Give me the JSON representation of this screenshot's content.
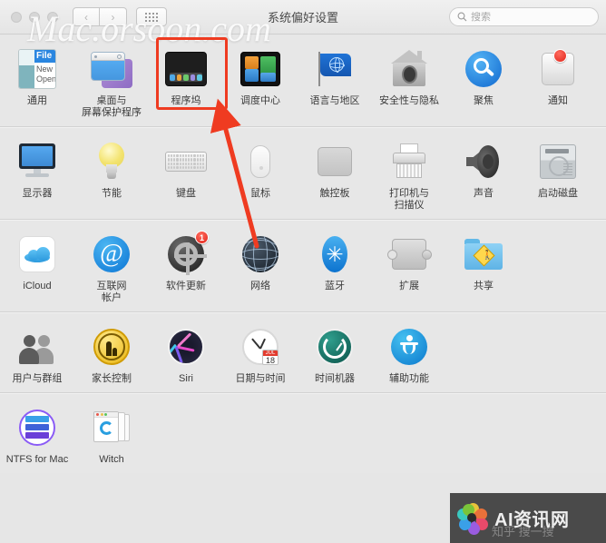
{
  "window": {
    "title": "系统偏好设置",
    "nav": {
      "back": "‹",
      "forward": "›",
      "grid_label": "show-all"
    },
    "search": {
      "placeholder": "搜索",
      "value": "",
      "icon": "search-icon"
    }
  },
  "watermarks": {
    "top": "Mac.orsoon.com",
    "bottom_text": "AI资讯网",
    "bottom_sub": "知乎 搜一搜"
  },
  "annotation": {
    "highlighted_item": "程序坞",
    "highlight_color": "#ef3b21",
    "arrow_color": "#ef3b21"
  },
  "rows": [
    {
      "items": [
        {
          "label": "通用",
          "icon": "general-icon",
          "badge": null
        },
        {
          "label": "桌面与\n屏幕保护程序",
          "icon": "desktop-screensaver-icon",
          "badge": null
        },
        {
          "label": "程序坞",
          "icon": "dock-icon",
          "badge": null
        },
        {
          "label": "调度中心",
          "icon": "mission-control-icon",
          "badge": null
        },
        {
          "label": "语言与地区",
          "icon": "language-region-icon",
          "badge": null
        },
        {
          "label": "安全性与隐私",
          "icon": "security-privacy-icon",
          "badge": null
        },
        {
          "label": "聚焦",
          "icon": "spotlight-icon",
          "badge": null
        },
        {
          "label": "通知",
          "icon": "notifications-icon",
          "badge": " "
        }
      ]
    },
    {
      "items": [
        {
          "label": "显示器",
          "icon": "displays-icon",
          "badge": null
        },
        {
          "label": "节能",
          "icon": "energy-saver-icon",
          "badge": null
        },
        {
          "label": "键盘",
          "icon": "keyboard-icon",
          "badge": null
        },
        {
          "label": "鼠标",
          "icon": "mouse-icon",
          "badge": null
        },
        {
          "label": "触控板",
          "icon": "trackpad-icon",
          "badge": null
        },
        {
          "label": "打印机与\n扫描仪",
          "icon": "printers-scanners-icon",
          "badge": null
        },
        {
          "label": "声音",
          "icon": "sound-icon",
          "badge": null
        },
        {
          "label": "启动磁盘",
          "icon": "startup-disk-icon",
          "badge": null
        }
      ]
    },
    {
      "items": [
        {
          "label": "iCloud",
          "icon": "icloud-icon",
          "badge": null
        },
        {
          "label": "互联网\n帐户",
          "icon": "internet-accounts-icon",
          "badge": null
        },
        {
          "label": "软件更新",
          "icon": "software-update-icon",
          "badge": "1"
        },
        {
          "label": "网络",
          "icon": "network-icon",
          "badge": null
        },
        {
          "label": "蓝牙",
          "icon": "bluetooth-icon",
          "badge": null
        },
        {
          "label": "扩展",
          "icon": "extensions-icon",
          "badge": null
        },
        {
          "label": "共享",
          "icon": "sharing-icon",
          "badge": null
        }
      ]
    },
    {
      "items": [
        {
          "label": "用户与群组",
          "icon": "users-groups-icon",
          "badge": null
        },
        {
          "label": "家长控制",
          "icon": "parental-controls-icon",
          "badge": null
        },
        {
          "label": "Siri",
          "icon": "siri-icon",
          "badge": null
        },
        {
          "label": "日期与时间",
          "icon": "date-time-icon",
          "badge": null
        },
        {
          "label": "时间机器",
          "icon": "time-machine-icon",
          "badge": null
        },
        {
          "label": "辅助功能",
          "icon": "accessibility-icon",
          "badge": null
        }
      ]
    },
    {
      "items": [
        {
          "label": "NTFS for Mac",
          "icon": "ntfs-for-mac-icon",
          "badge": null
        },
        {
          "label": "Witch",
          "icon": "witch-icon",
          "badge": null
        }
      ]
    }
  ],
  "date_icon": {
    "month": "JUL",
    "day": "18"
  }
}
